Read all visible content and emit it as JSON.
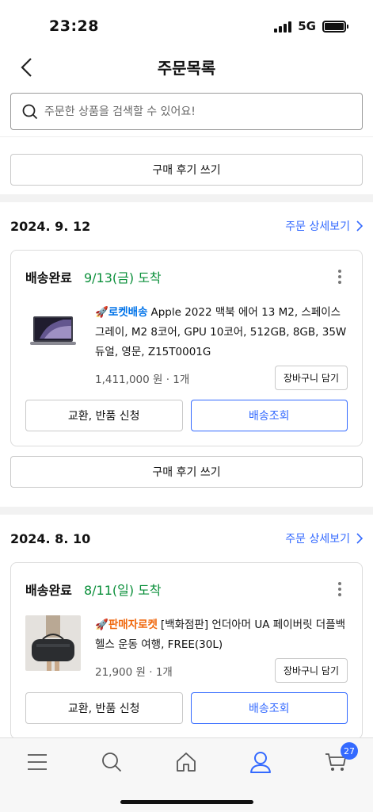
{
  "status_bar": {
    "time": "23:28",
    "network": "5G"
  },
  "header": {
    "title": "주문목록"
  },
  "search": {
    "placeholder": "주문한 상품을 검색할 수 있어요!"
  },
  "review_label": "구매 후기 쓰기",
  "orders": [
    {
      "date": "2024. 9. 12",
      "detail_label": "주문 상세보기",
      "status": "배송완료",
      "arrival": "9/13(금) 도착",
      "badge": "로켓배송",
      "product": "Apple 2022 맥북 에어 13 M2, 스페이스그레이, M2 8코어, GPU 10코어, 512GB, 8GB, 35W 듀얼, 영문, Z15T0001G",
      "price": "1,411,000 원 · 1개",
      "cart_label": "장바구니 담기",
      "exchange_label": "교환, 반품 신청",
      "track_label": "배송조회"
    },
    {
      "date": "2024. 8. 10",
      "detail_label": "주문 상세보기",
      "status": "배송완료",
      "arrival": "8/11(일) 도착",
      "badge": "판매자로켓",
      "product": "[백화점판] 언더아머 UA 페이버릿 더플백 헬스 운동 여행, FREE(30L)",
      "price": "21,900 원 · 1개",
      "cart_label": "장바구니 담기",
      "exchange_label": "교환, 반품 신청",
      "track_label": "배송조회"
    }
  ],
  "tabbar": {
    "items": [
      "menu-icon",
      "search-icon",
      "home-icon",
      "my-account-icon",
      "cart-icon"
    ],
    "active": "my-account-icon",
    "cart_count": "27"
  },
  "colors": {
    "accent": "#346aff",
    "arrival_green": "#0a8f3a",
    "rocket_blue": "#0073e9",
    "seller_orange": "#f0670c"
  }
}
